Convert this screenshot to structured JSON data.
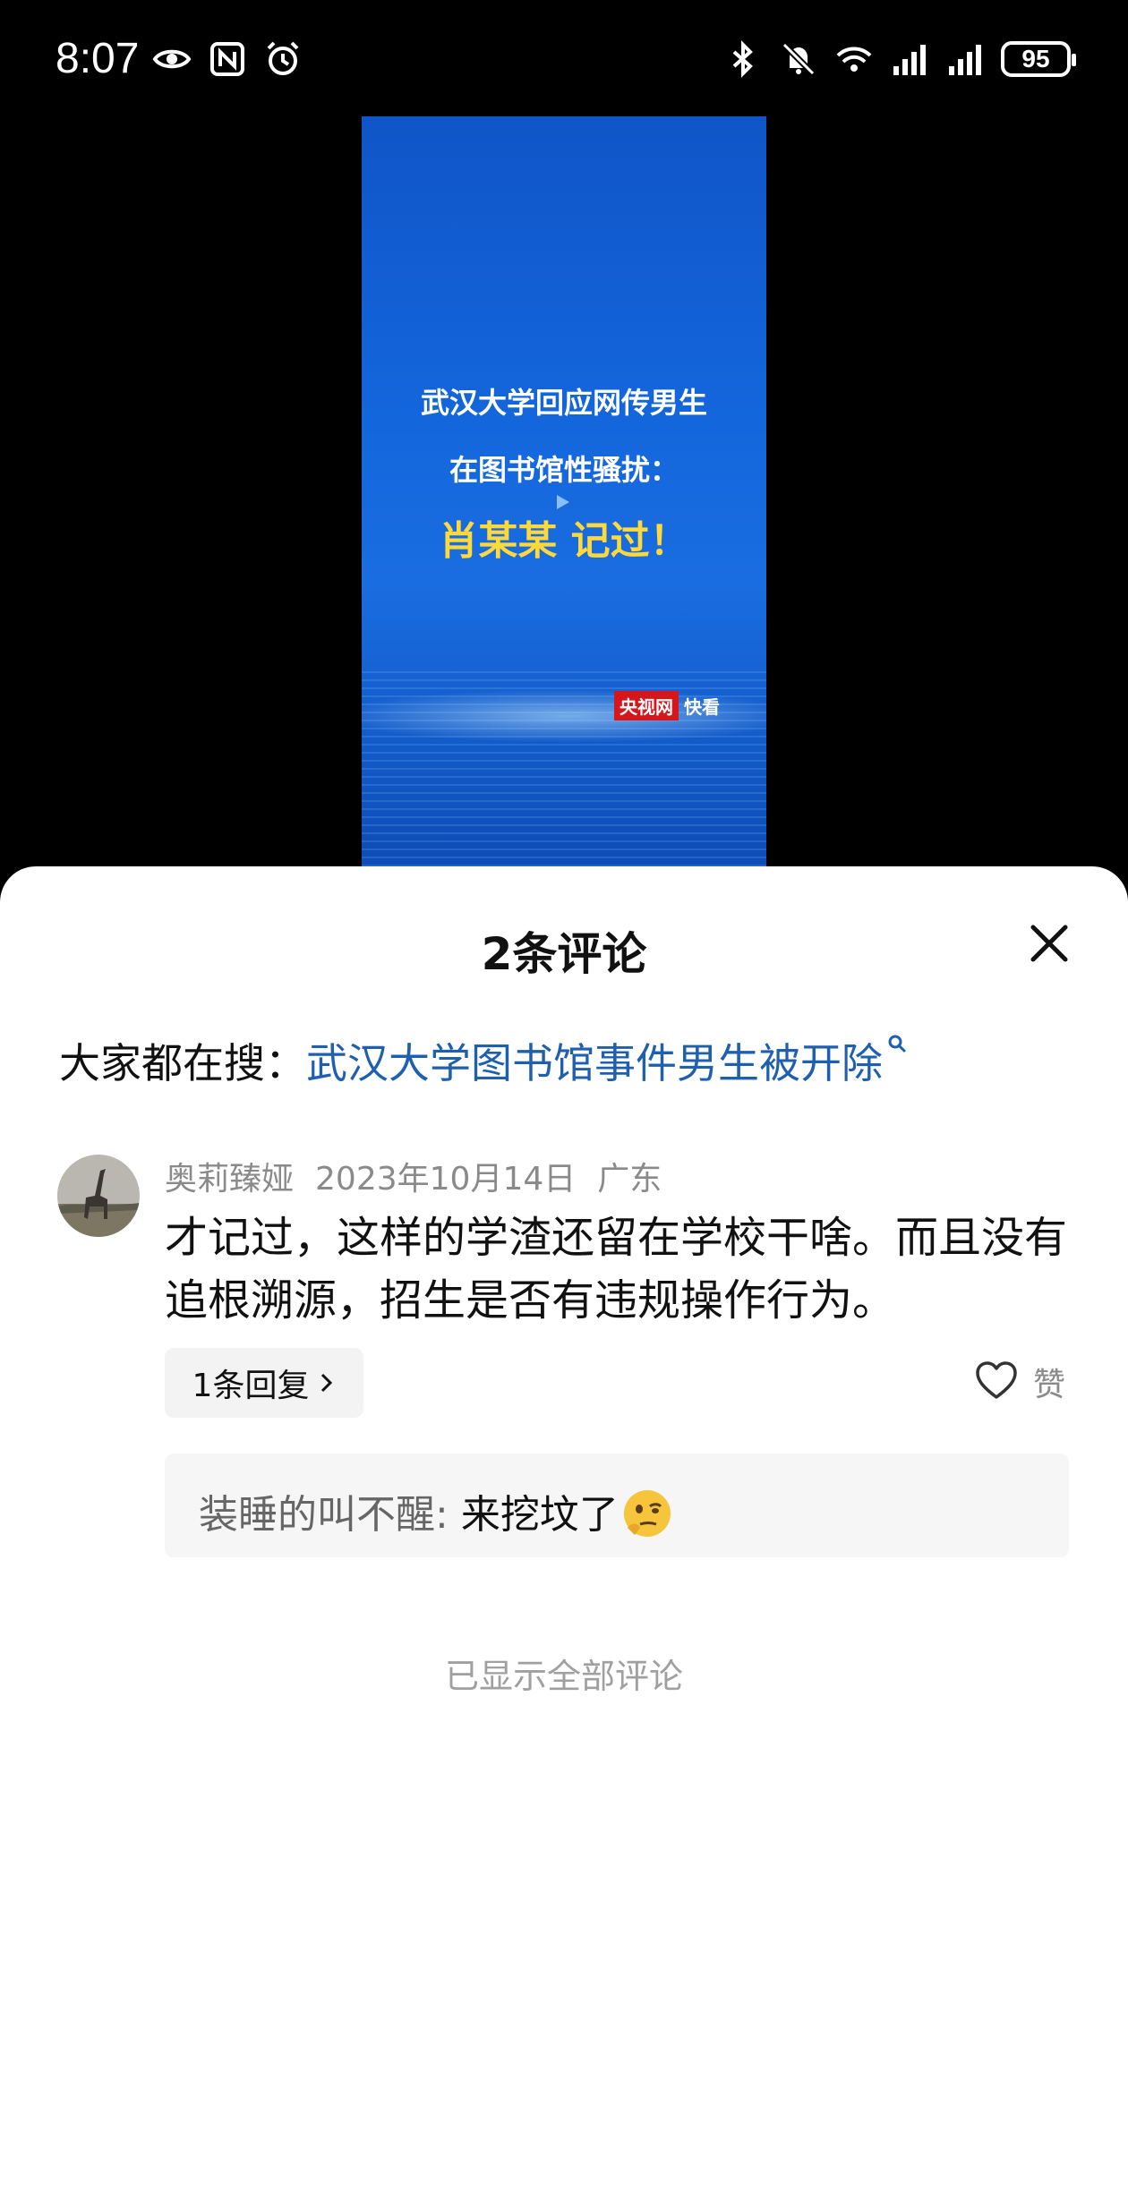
{
  "status_bar": {
    "time": "8:07",
    "battery": "95"
  },
  "video": {
    "line1": "武汉大学回应网传男生",
    "line2": "在图书馆性骚扰：",
    "line3": "肖某某 记过！",
    "logo_brand": "央视网",
    "logo_suffix": "快看",
    "colors": {
      "background": "#1466dc",
      "highlight": "#ffd83a"
    }
  },
  "sheet": {
    "title": "2条评论",
    "search_label": "大家都在搜：",
    "search_term": "武汉大学图书馆事件男生被开除",
    "comment": {
      "author": "奥莉臻娅",
      "date": "2023年10月14日",
      "location": "广东",
      "text": "才记过，这样的学渣还留在学校干啥。而且没有追根溯源，招生是否有违规操作行为。",
      "reply_button": "1条回复",
      "like_label": "赞",
      "reply": {
        "author": "装睡的叫不醒:",
        "text": " 来挖坟了",
        "emoji": "thinking-face-emoji"
      }
    },
    "end_text": "已显示全部评论"
  }
}
